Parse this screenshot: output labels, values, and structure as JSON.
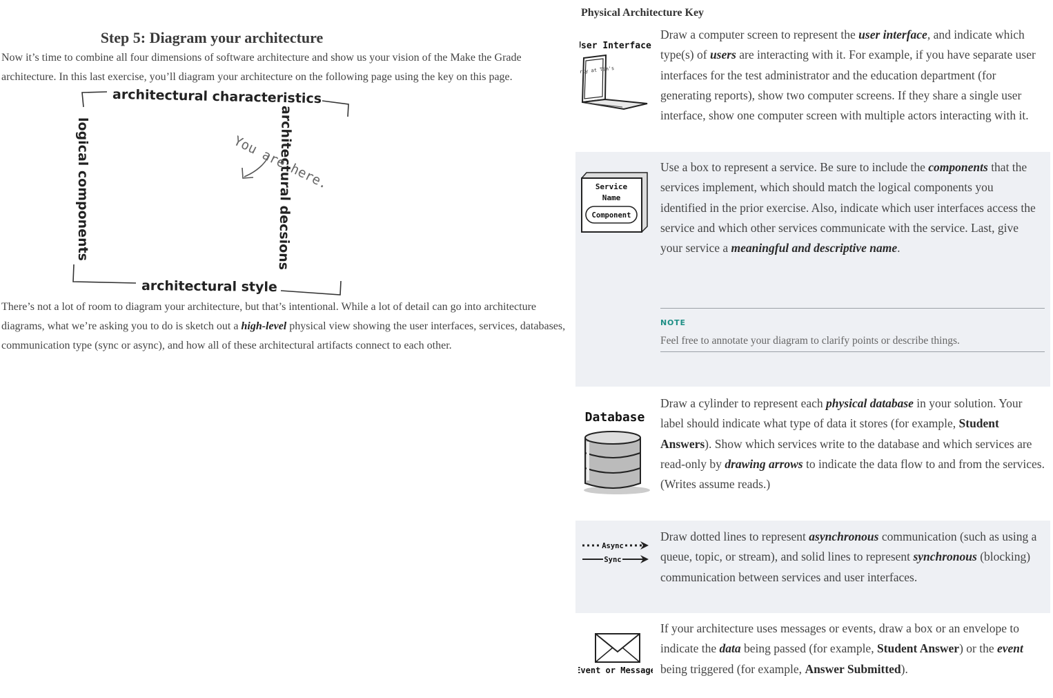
{
  "left": {
    "title": "Step 5: Diagram your architecture",
    "intro": "Now it’s time to combine all four dimensions of software architecture and show us your vision of the Make the Grade architecture. In this last exercise, you’ll diagram your architecture on the following page using the key on this page.",
    "diagram": {
      "top": "architectural characteristics",
      "left": "logical components",
      "right": "architectural decsions",
      "bottom": "architectural style",
      "note": "You are here."
    },
    "closing": {
      "before": "There’s not a lot of room to diagram your architecture, but that’s intentional. While a lot of detail can go into architecture diagrams, what we’re asking you to do is sketch out a ",
      "emphasis": "high-level",
      "after": " physical view showing the user interfaces, services, databases, communication type (sync or async), and how all of these architectural artifacts connect to each other."
    }
  },
  "key": {
    "title": "Physical Architecture Key",
    "ui": {
      "icon_label": "User Interface",
      "screen_text": "Party at Tim's",
      "t1": "Draw a computer screen to represent the ",
      "e1": "user interface",
      "t2": ", and indicate which type(s) of ",
      "e2": "users",
      "t3": " are interacting with it. For example, if you have separate user interfaces for the test administrator and the education department (for generating reports), show two computer screens. If they share a single user interface, show one computer screen with multiple actors interacting with it."
    },
    "service": {
      "icon_name": "Service",
      "icon_name2": "Name",
      "icon_component": "Component",
      "t1": "Use a box to represent a service. Be sure to include the ",
      "e1": "components",
      "t2": " that the services implement, which should match the logical compo­nents you identified in the prior exercise. Also, indicate which user interfaces access the service and which other services communicate with the service. Last, give your service a ",
      "e2": "meaningful and descrip­tive name",
      "t3": "."
    },
    "note": {
      "label": "NOTE",
      "text": "Feel free to annotate your diagram to clarify points or describe things."
    },
    "database": {
      "icon_label": "Database",
      "t1": "Draw a cylinder to represent each ",
      "e1": "physical database",
      "t2": " in your solution. Your label should indicate what type of data it stores (for example, ",
      "b1": "Student Answers",
      "t3": "). Show which services write to the database and which services are read-only by ",
      "e2": "drawing arrows",
      "t4": " to indicate the data flow to and from the services. (Writes assume reads.)"
    },
    "comm": {
      "async_label": "Async",
      "sync_label": "Sync",
      "t1": "Draw dotted lines to represent ",
      "e1": "asynchronous",
      "t2": " communication (such as using a queue, topic, or stream), and solid lines to represent ",
      "e2": "synchronous",
      "t3": " (blocking) communication between services and user interfaces."
    },
    "event": {
      "icon_label": "Event or Message",
      "t1": "If your architecture uses messages or events, draw a box or an envelope to indicate the ",
      "e1": "data",
      "t2": " being passed (for example, ",
      "b1": "Student Answer",
      "t3": ") or the ",
      "e2": "event",
      "t4": " being triggered (for example, ",
      "b2": "Answer Submitted",
      "t5": ")."
    }
  }
}
